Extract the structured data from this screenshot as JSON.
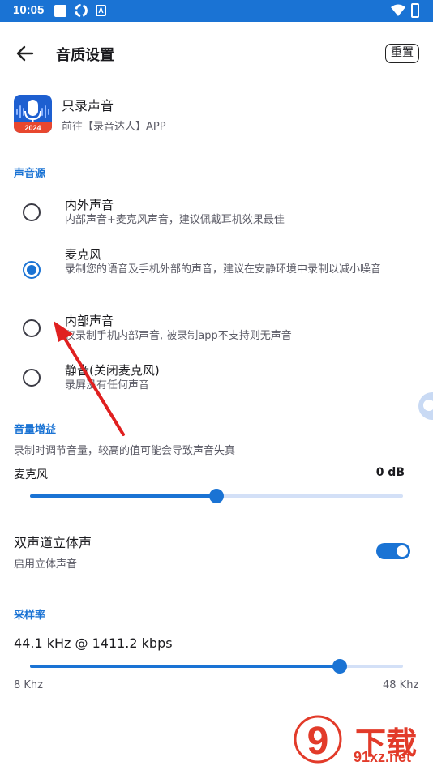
{
  "status_bar": {
    "time": "10:05"
  },
  "app_bar": {
    "title": "音质设置",
    "reset_label": "重置"
  },
  "promo": {
    "title": "只录声音",
    "subtitle": "前往【录音达人】APP",
    "logo_year": "2024"
  },
  "sound_source": {
    "header": "声音源",
    "options": [
      {
        "title": "内外声音",
        "desc": "内部声音+麦克风声音，建议佩戴耳机效果最佳",
        "selected": false
      },
      {
        "title": "麦克风",
        "desc": "录制您的语音及手机外部的声音，建议在安静环境中录制以减小噪音",
        "selected": true
      },
      {
        "title": "内部声音",
        "desc": "仅录制手机内部声音, 被录制app不支持则无声音",
        "selected": false
      },
      {
        "title": "静音(关闭麦克风)",
        "desc": "录屏没有任何声音",
        "selected": false
      }
    ]
  },
  "volume_gain": {
    "header": "音量增益",
    "desc": "录制时调节音量，较高的值可能会导致声音失真",
    "mic_label": "麦克风",
    "mic_value": "0 dB",
    "slider_fraction": 0.5
  },
  "stereo": {
    "title": "双声道立体声",
    "desc": "启用立体声音",
    "enabled": true
  },
  "sample_rate": {
    "header": "采样率",
    "value": "44.1 kHz @ 1411.2 kbps",
    "min_label": "8 Khz",
    "max_label": "48 Khz",
    "slider_fraction": 0.83
  },
  "watermark": {
    "text": "下载站",
    "url": "91xz.net",
    "glyph": "9"
  },
  "colors": {
    "accent": "#1a73d4",
    "watermark": "#e23b2a"
  }
}
